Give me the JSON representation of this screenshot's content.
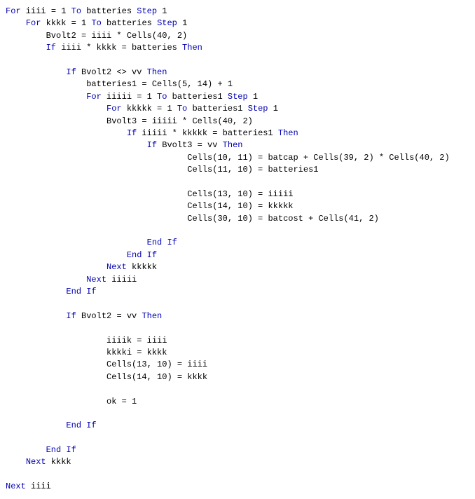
{
  "code": {
    "kw_for": "For",
    "kw_to": "To",
    "kw_step": "Step",
    "kw_if": "If",
    "kw_then": "Then",
    "kw_endif": "End If",
    "kw_next": "Next",
    "l1a": " iiii = 1 ",
    "l1b": " batteries ",
    "l1c": " 1",
    "l2a": " kkkk = 1 ",
    "l2b": " batteries ",
    "l2c": " 1",
    "l3": "        Bvolt2 = iiii * Cells(40, 2)",
    "l4": " iiii * kkkk = batteries ",
    "l5": " Bvolt2 <> vv ",
    "l6": "                batteries1 = Cells(5, 14) + 1",
    "l7a": " iiiii = 1 ",
    "l7b": " batteries1 ",
    "l7c": " 1",
    "l8a": " kkkkk = 1 ",
    "l8b": " batteries1 ",
    "l8c": " 1",
    "l9": "                    Bvolt3 = iiiii * Cells(40, 2)",
    "l10": " iiiii * kkkkk = batteries1 ",
    "l11": " Bvolt3 = vv ",
    "l12": "                                    Cells(10, 11) = batcap + Cells(39, 2) * Cells(40, 2)",
    "l13": "                                    Cells(11, 10) = batteries1",
    "l14": "                                    Cells(13, 10) = iiiii",
    "l15": "                                    Cells(14, 10) = kkkkk",
    "l16": "                                    Cells(30, 10) = batcost + Cells(41, 2)",
    "l17": " Bvolt2 = vv ",
    "l18": "                    iiiik = iiii",
    "l19": "                    kkkki = kkkk",
    "l20": "                    Cells(13, 10) = iiii",
    "l21": "                    Cells(14, 10) = kkkk",
    "l22": "                    ok = 1",
    "nx_kkkkk": " kkkkk",
    "nx_iiiii": " iiiii",
    "nx_kkkk": " kkkk",
    "nx_iiii": " iiii"
  }
}
